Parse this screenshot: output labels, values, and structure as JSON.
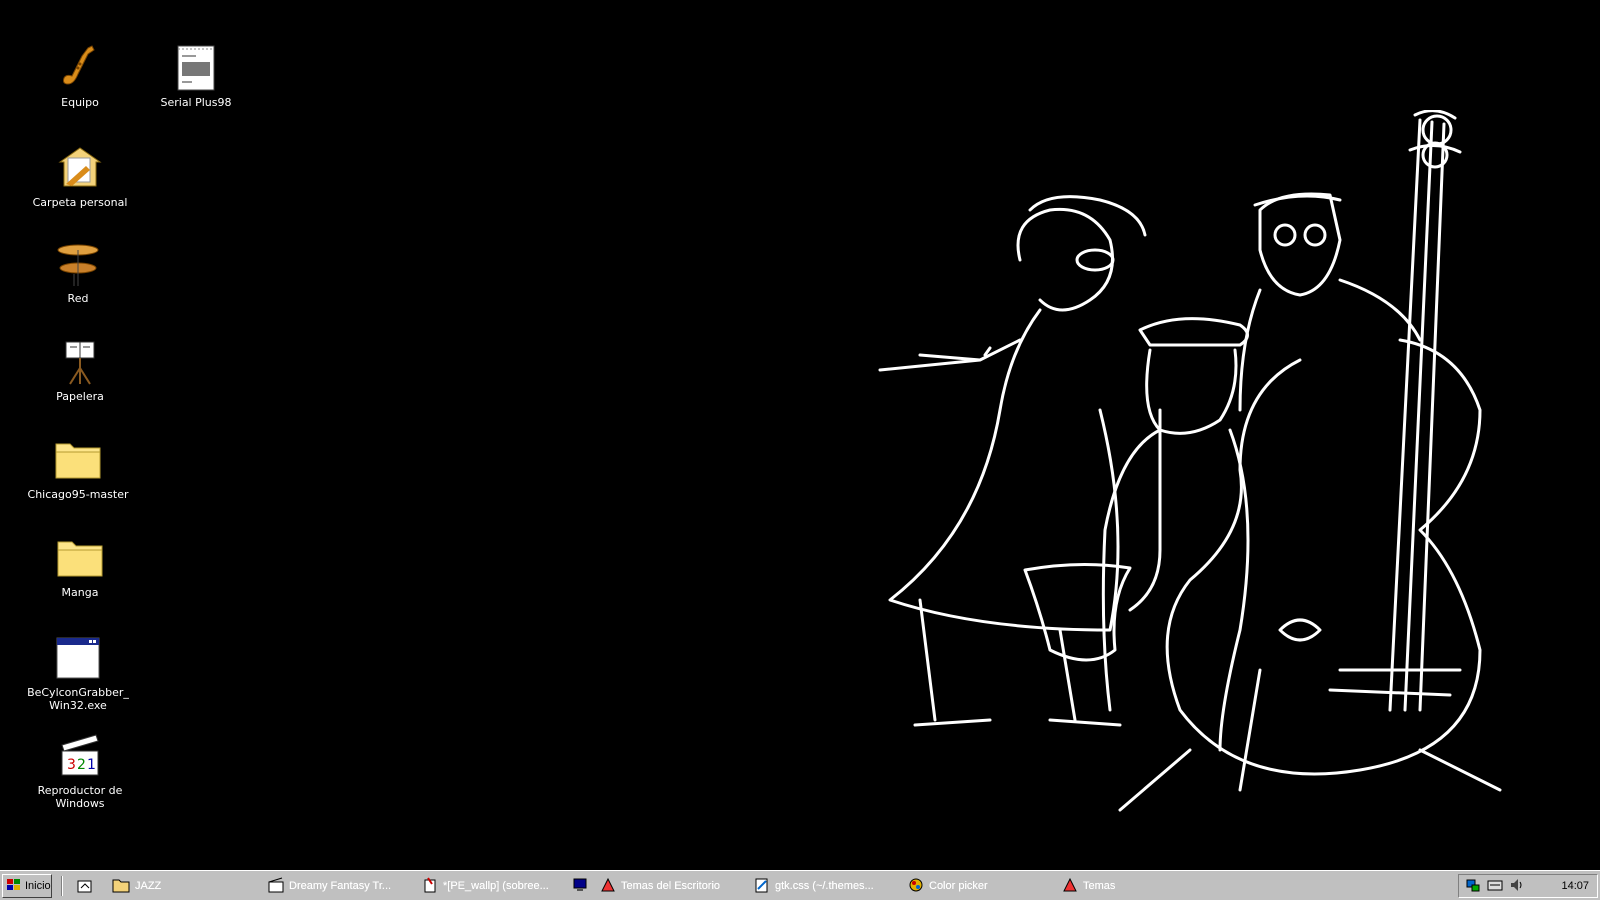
{
  "desktop": {
    "icons": [
      {
        "label": "Equipo",
        "icon": "saxophone-icon"
      },
      {
        "label": "Serial Plus98",
        "icon": "notepad-icon"
      },
      {
        "label": "Carpeta personal",
        "icon": "home-folder-icon"
      },
      {
        "label": "Red",
        "icon": "cymbals-icon"
      },
      {
        "label": "Papelera",
        "icon": "music-stand-icon"
      },
      {
        "label": "Chicago95-master",
        "icon": "folder-icon"
      },
      {
        "label": "Manga",
        "icon": "folder-icon"
      },
      {
        "label": "BeCylconGrabber_\nWin32.exe",
        "icon": "application-window-icon"
      },
      {
        "label": "Reproductor de\nWindows",
        "icon": "media-player-icon"
      }
    ]
  },
  "taskbar": {
    "start_label": "Inicio",
    "tasks": [
      {
        "label": "JAZZ",
        "icon": "folder-icon"
      },
      {
        "label": "Dreamy Fantasy Tr...",
        "icon": "movie-icon"
      },
      {
        "label": "*[PE_wallp] (sobree...",
        "icon": "paint-icon"
      },
      {
        "label": "",
        "icon": "display-icon"
      },
      {
        "label": "Temas del Escritorio",
        "icon": "themes-icon"
      },
      {
        "label": "gtk.css (~/.themes...",
        "icon": "text-editor-icon"
      },
      {
        "label": "Color picker",
        "icon": "color-picker-icon"
      },
      {
        "label": "Temas",
        "icon": "themes-icon"
      }
    ],
    "clock": "14:07"
  }
}
